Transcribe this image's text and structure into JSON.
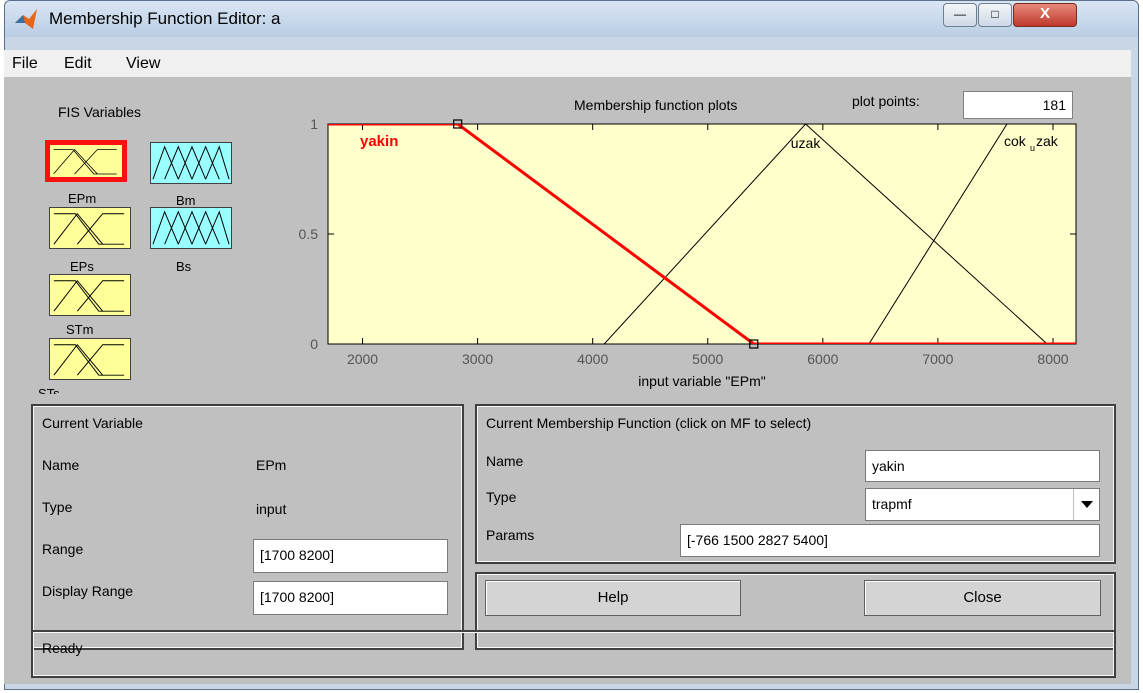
{
  "window": {
    "title": "Membership Function Editor: a",
    "min_glyph": "—",
    "max_glyph": "□",
    "close_glyph": "X"
  },
  "menu": {
    "items": [
      "File",
      "Edit",
      "View"
    ]
  },
  "fis_variables": {
    "title": "FIS Variables",
    "items": [
      {
        "label": "EPm",
        "color": "#ffff99",
        "selected": true
      },
      {
        "label": "Bm",
        "color": "#99ffff",
        "selected": false
      },
      {
        "label": "EPs",
        "color": "#ffff99",
        "selected": false
      },
      {
        "label": "Bs",
        "color": "#99ffff",
        "selected": false
      },
      {
        "label": "STm",
        "color": "#ffff99",
        "selected": false
      },
      {
        "label": "STs",
        "color": "#ffff99",
        "selected": false
      }
    ]
  },
  "plot_header": {
    "title": "Membership function plots",
    "plot_points_label": "plot points:",
    "plot_points_value": "181"
  },
  "chart_data": {
    "type": "line",
    "xlabel": "input variable \"EPm\"",
    "xlim": [
      1700,
      8200
    ],
    "ylim": [
      0,
      1
    ],
    "x_ticks": [
      2000,
      3000,
      4000,
      5000,
      6000,
      7000,
      8000
    ],
    "y_ticks": [
      0,
      0.5,
      1
    ],
    "y_tick_labels": [
      "0",
      "0.5",
      "1"
    ],
    "background": "#ffffcc",
    "series": [
      {
        "name": "yakin",
        "color": "#ff0000",
        "selected": true,
        "points": [
          [
            -766,
            0
          ],
          [
            1500,
            1
          ],
          [
            2827,
            1
          ],
          [
            5400,
            0
          ]
        ]
      },
      {
        "name": "uzak",
        "color": "#000000",
        "selected": false,
        "points": [
          [
            4100,
            0
          ],
          [
            5850,
            1
          ],
          [
            7950,
            0
          ]
        ]
      },
      {
        "name": "cok_uzak",
        "color": "#000000",
        "selected": false,
        "points": [
          [
            6400,
            0
          ],
          [
            7600,
            1
          ],
          [
            8200,
            1
          ],
          [
            9000,
            1
          ]
        ]
      }
    ],
    "series_labels": {
      "yakin": "yakin",
      "uzak": "uzak",
      "cok_uzak_main": "cok",
      "cok_uzak_sub": "u",
      "cok_uzak_tail": "zak"
    }
  },
  "current_variable": {
    "title": "Current Variable",
    "name_label": "Name",
    "name_value": "EPm",
    "type_label": "Type",
    "type_value": "input",
    "range_label": "Range",
    "range_value": "[1700 8200]",
    "display_range_label": "Display Range",
    "display_range_value": "[1700 8200]"
  },
  "current_mf": {
    "title": "Current Membership Function (click on MF to select)",
    "name_label": "Name",
    "name_value": "yakin",
    "type_label": "Type",
    "type_value": "trapmf",
    "params_label": "Params",
    "params_value": "[-766 1500 2827 5400]"
  },
  "buttons": {
    "help": "Help",
    "close": "Close"
  },
  "status": {
    "text": "Ready"
  }
}
